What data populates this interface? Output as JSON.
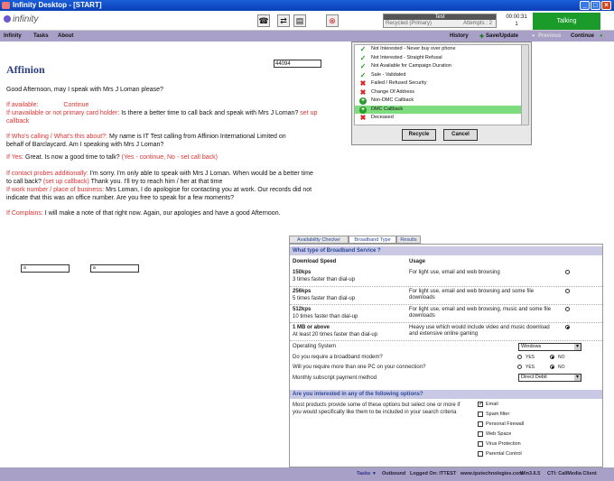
{
  "window": {
    "title": "Infinity Desktop - [START]"
  },
  "app": {
    "logo_text": "infinity"
  },
  "campaign": {
    "name": "Test",
    "status": "Recycled (Primary)",
    "attempts": "Attempts : 2"
  },
  "timer": {
    "elapsed": "00:00:31",
    "count": "1"
  },
  "call_state": "Talking",
  "menu": {
    "infinity": "Infinity",
    "tasks": "Tasks",
    "about": "About",
    "history": "History",
    "save_update": "Save/Update",
    "previous": "Previous",
    "continue": "Continue"
  },
  "brand": {
    "name": "Affinion"
  },
  "reference": "44094",
  "script": {
    "greeting": "Good Afternoon, may I speak with Mrs J Loman please?",
    "if_available": "If available:",
    "continue_link": "Continue",
    "if_unavailable": "If unavailable or not primary card holder:",
    "unavailable_text": " Is there a better time to call back and speak with Mrs J Loman?",
    "setup_callback": "set up callback",
    "if_who": "If Who's calling / What's this about?:",
    "who_text": " My name is IT Test calling from Affinion International Limited on behalf of Barclaycard. Am I speaking with Mrs J Loman?",
    "if_yes": "If Yes:",
    "yes_text": " Great. Is now a good time to talk?",
    "yes_options": "(Yes - continue, No - set call back)",
    "if_contact": "If contact probes additionally:",
    "contact_text": " I'm sorry. I'm only able to speak with Mrs J Loman. When would be a better time to call back?",
    "contact_callback": "(set up callback)",
    "contact_text2": " Thank you. I'll try to reach him / her at that time",
    "if_work": "If work number / place of business:",
    "work_text": " Mrs Loman, I do apologise for contacting you at work. Our records did not indicate that this was an office number. Are you free to speak for a few moments?",
    "if_complains": "If Complains:",
    "complains_text": " I will make a note of that right now. Again, our apologies and have a good Afternoon."
  },
  "inputs": {
    "a1": "a",
    "a2": "a"
  },
  "dispositions": {
    "items": [
      {
        "label": "Not Interested - Never buy over phone",
        "icon": "check-icon"
      },
      {
        "label": "Not Interested - Straight Refusal",
        "icon": "check-icon"
      },
      {
        "label": "Not Available for Campaign Duration",
        "icon": "check-icon"
      },
      {
        "label": "Sale - Validated",
        "icon": "check-icon"
      },
      {
        "label": "Failed / Refused Security",
        "icon": "cross-icon"
      },
      {
        "label": "Change Of Address",
        "icon": "cross-icon"
      },
      {
        "label": "Non-DMC Callback",
        "icon": "plus-icon"
      },
      {
        "label": "DMC Callback",
        "icon": "plus-icon"
      },
      {
        "label": "Deceased",
        "icon": "cross-icon"
      }
    ],
    "selected": "DMC Callback",
    "recycle": "Recycle",
    "cancel": "Cancel"
  },
  "tabs": [
    "Availability Checker",
    "Broadband Type",
    "Results"
  ],
  "broadband": {
    "question": "What type of Broadband Service ?",
    "col_speed": "Download Speed",
    "col_usage": "Usage",
    "options": [
      {
        "speed": "150kps",
        "desc": "3 times faster than dial-up",
        "usage": "For light use, email and web browsing",
        "selected": false
      },
      {
        "speed": "256kps",
        "desc": "5 times faster than dial-up",
        "usage": "For light use, email and web browsing and some file downloads",
        "selected": false
      },
      {
        "speed": "512kps",
        "desc": "10 times faster than dial-up",
        "usage": "For light use, email and web browsing, music and some file downloads",
        "selected": false
      },
      {
        "speed": "1 MB or above",
        "desc": "At least 20 times faster than dial-up",
        "usage": "Heavy use which would include video and music download and extensive online gaming",
        "selected": true
      }
    ],
    "os_label": "Operating System",
    "os_value": "Windows",
    "modem_label": "Do you require a broadband modem?",
    "multi_pc_label": "Will you require more than one PC on your connection?",
    "payment_label": "Monthly subscript payment method",
    "payment_value": "Direct Debit",
    "yes": "YES",
    "no": "NO"
  },
  "options": {
    "question": "Are you interested in any of the following options?",
    "desc": "Most products provide some of these options but select one or more if you would specifically like them to be included in your search criteria",
    "items": [
      {
        "label": "Email",
        "checked": true
      },
      {
        "label": "Spam filter",
        "checked": false
      },
      {
        "label": "Personal Firewall",
        "checked": false
      },
      {
        "label": "Web Space",
        "checked": false
      },
      {
        "label": "Virus Protection",
        "checked": false
      },
      {
        "label": "Parental Control",
        "checked": false
      }
    ]
  },
  "status": {
    "tasks": "Tasks",
    "outbound": "Outbound",
    "logged_on": "Logged On: ITTEST",
    "site": "www.tpstechnologies.com",
    "version": "Win3.6.5",
    "cti": "CTI: CallMedia Client"
  },
  "colors": {
    "titlebar": "#0a3fb6",
    "menubar": "#a9a0c8",
    "talking": "#1a9b2a",
    "selected": "#7ddc7d",
    "accent_red": "#dd3333"
  }
}
